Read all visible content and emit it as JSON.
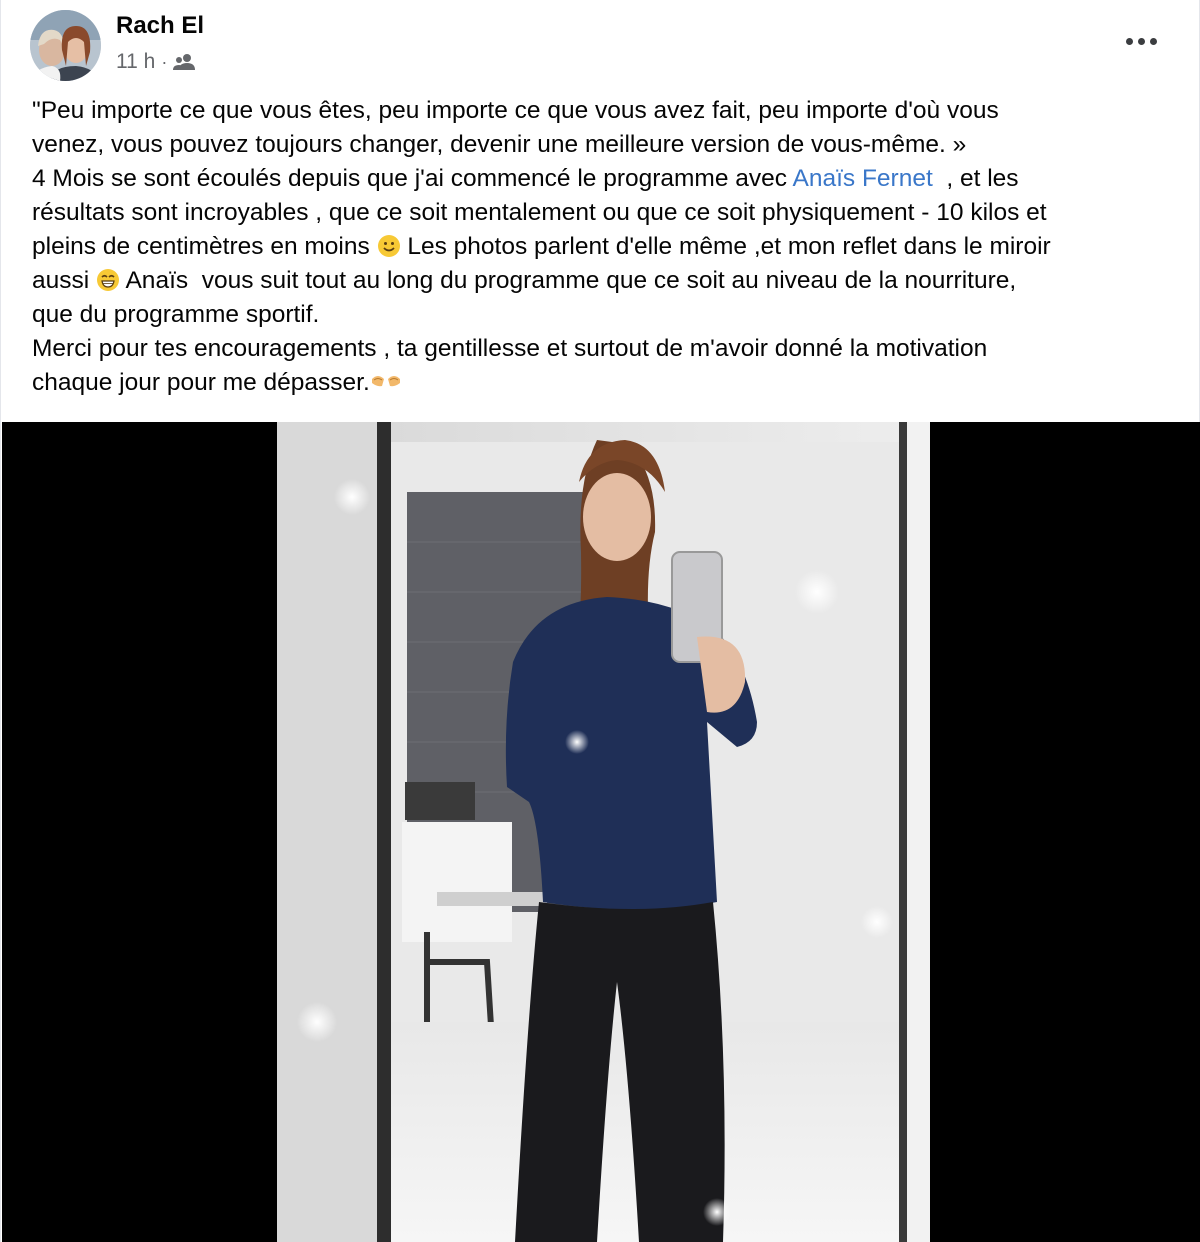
{
  "post": {
    "author_name": "Rach El",
    "timestamp": "11 h",
    "separator": "·",
    "audience_icon": "friends-icon",
    "more_icon": "more-horizontal-icon",
    "message": {
      "line1": "\"Peu importe ce que vous êtes, peu importe ce que vous avez fait, peu importe d'où vous",
      "line2": "venez, vous pouvez toujours changer, devenir une meilleure version de vous-même. »",
      "line3_before": "4 Mois se sont écoulés depuis que j'ai commencé le programme avec ",
      "mention": "Anaïs Fernet",
      "line3_after": "  , et les",
      "line4": "résultats sont incroyables , que ce soit mentalement ou que ce soit physiquement - 10 kilos et",
      "line5_before": "pleins de centimètres en moins ",
      "line5_after": " Les photos parlent d'elle même ,et mon reflet dans le miroir",
      "line6_before": "aussi ",
      "line6_after": " Anaïs  vous suit tout au long du programme que ce soit au niveau de la nourriture,",
      "line7": "que du programme sportif.",
      "line8": "Merci pour tes encouragements , ta gentillesse et surtout de m'avoir donné la motivation",
      "line9": "chaque jour pour me dépasser."
    },
    "emojis": [
      "slightly-smiling-face-emoji",
      "grinning-face-emoji",
      "heart-hands-emoji"
    ],
    "colors": {
      "mention": "#3a77c9",
      "meta": "#65676b",
      "photo_background": "#000000"
    }
  }
}
